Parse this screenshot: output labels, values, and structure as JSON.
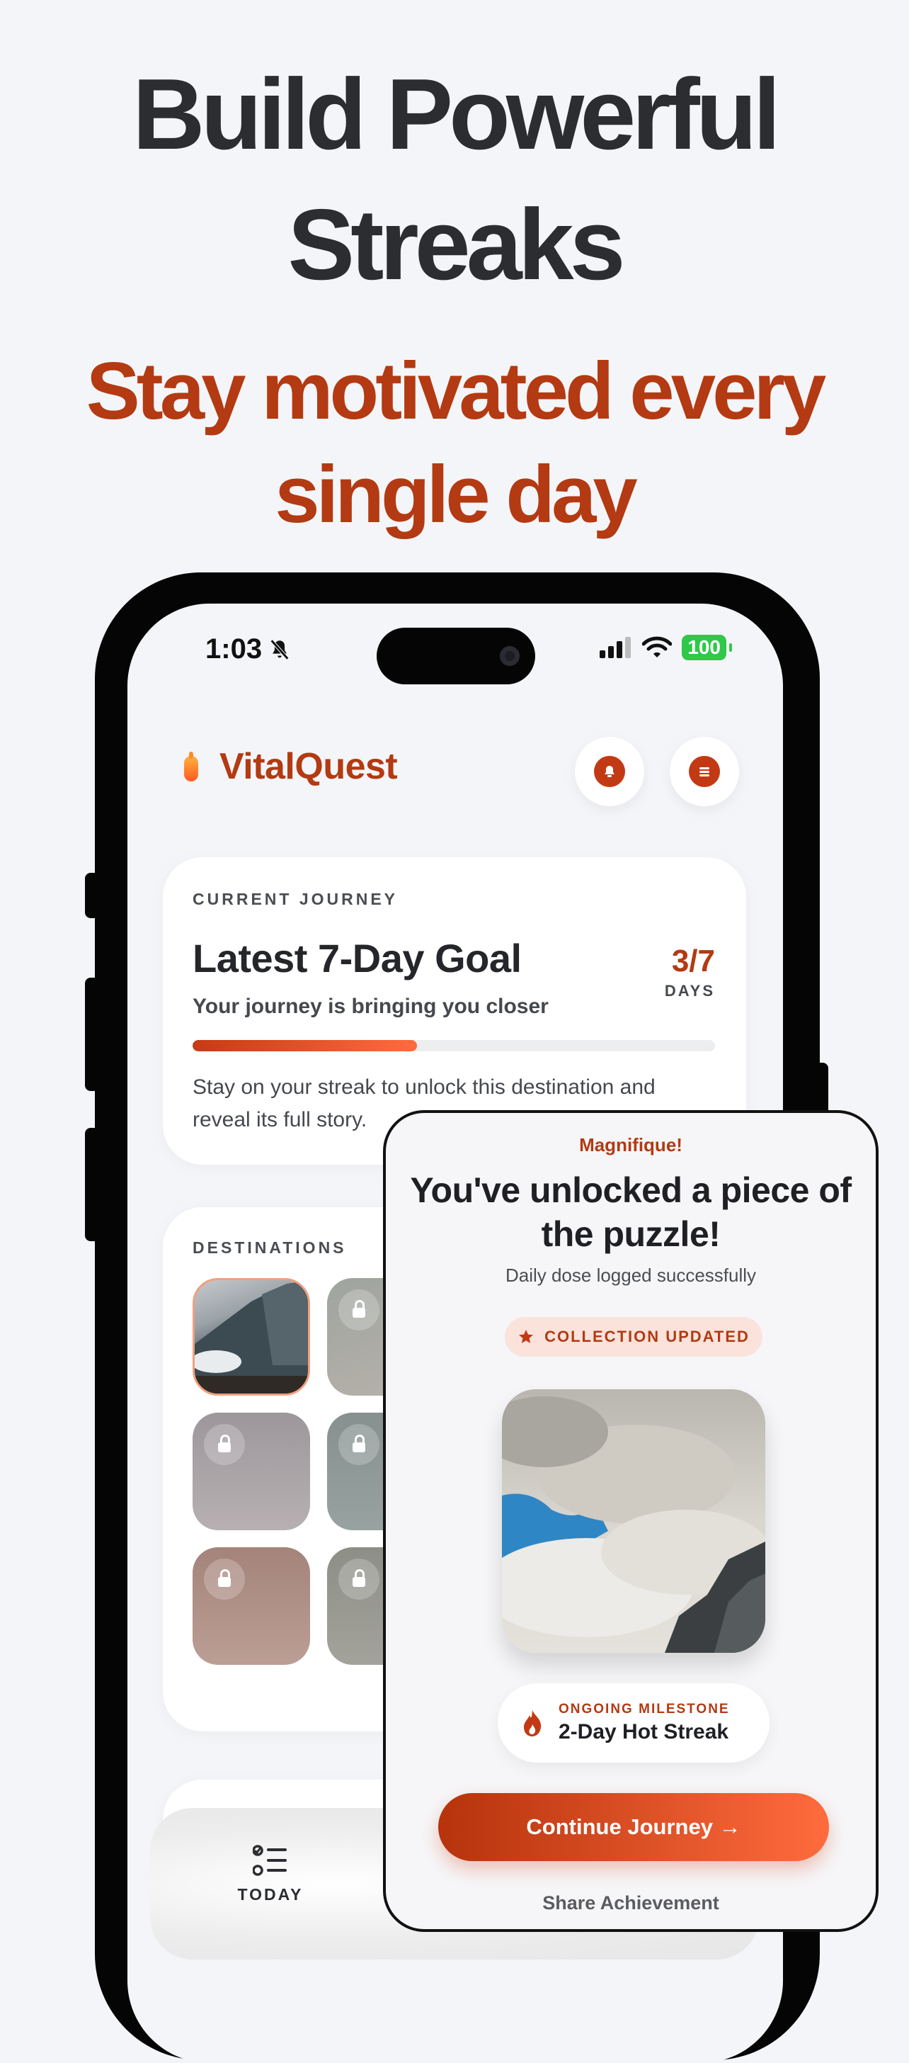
{
  "hero": {
    "title_line1": "Build Powerful",
    "title_line2": "Streaks",
    "subtitle_line1": "Stay motivated every",
    "subtitle_line2": "single day"
  },
  "status_bar": {
    "time": "1:03",
    "battery": "100"
  },
  "app": {
    "name": "VitalQuest"
  },
  "journey": {
    "eyebrow": "CURRENT JOURNEY",
    "title": "Latest 7-Day Goal",
    "subtitle": "Your journey is bringing you closer",
    "count": "3/7",
    "count_unit": "DAYS",
    "progress_fraction": 0.43,
    "description": "Stay on your streak to unlock this destination and reveal its full story."
  },
  "destinations": {
    "eyebrow": "DESTINATIONS"
  },
  "tabbar": {
    "today_label": "TODAY"
  },
  "modal": {
    "kicker": "Magnifique!",
    "title": "You've unlocked a piece of the puzzle!",
    "subtitle": "Daily dose logged successfully",
    "pill_label": "COLLECTION UPDATED",
    "milestone_eyebrow": "ONGOING MILESTONE",
    "milestone_name": "2-Day Hot Streak",
    "cta_label": "Continue Journey →",
    "share_label": "Share Achievement"
  },
  "colors": {
    "accent": "#b33a12",
    "accent_bright": "#ff6b3d",
    "heading": "#2b2d31",
    "background": "#f4f5f8"
  }
}
